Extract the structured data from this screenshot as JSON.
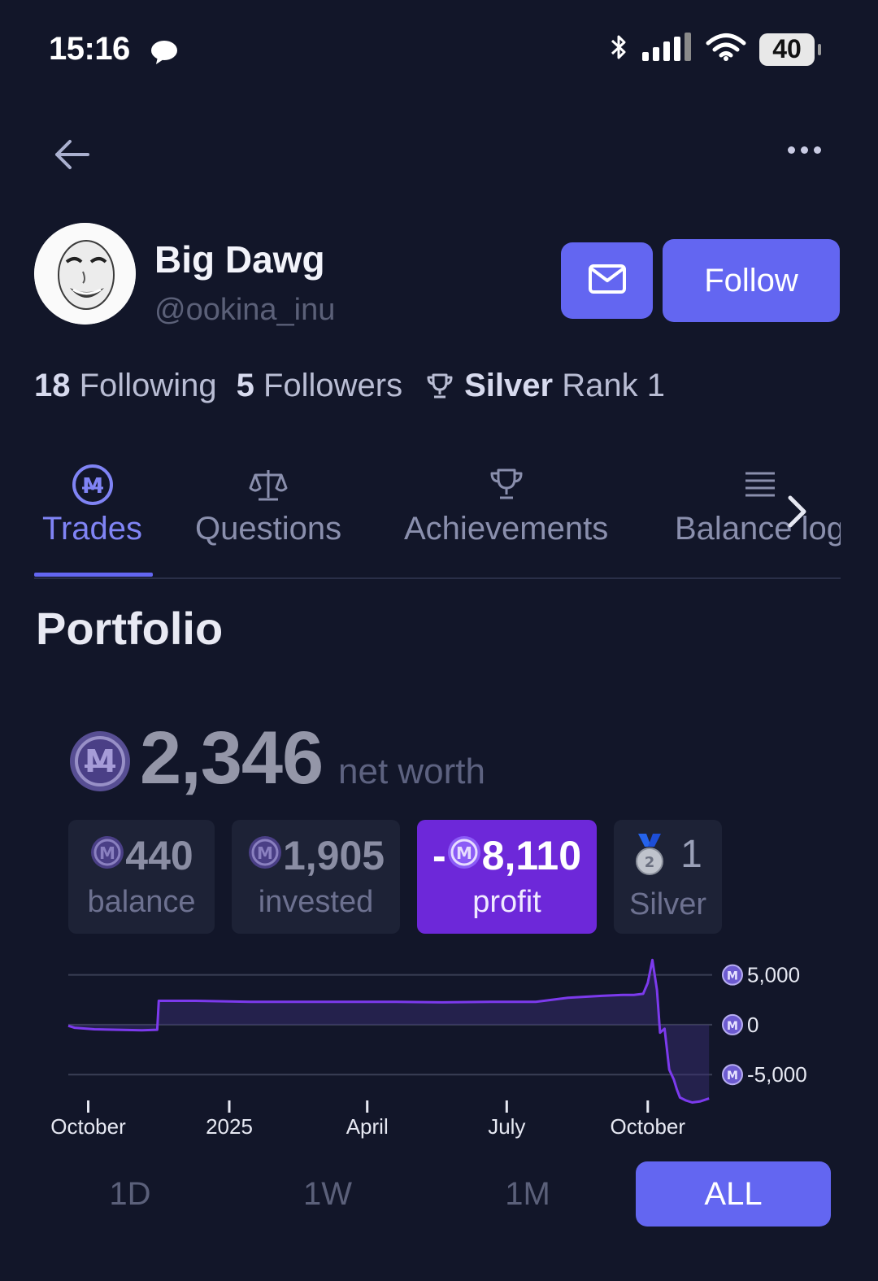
{
  "status_bar": {
    "time": "15:16",
    "battery": "40"
  },
  "profile": {
    "display_name": "Big Dawg",
    "username": "@ookina_inu",
    "follow_label": "Follow",
    "following_count": "18",
    "following_label": "Following",
    "followers_count": "5",
    "followers_label": "Followers",
    "league": "Silver",
    "rank_label": "Rank 1"
  },
  "tabs": [
    {
      "label": "Trades",
      "icon": "mana-coin-icon",
      "active": true
    },
    {
      "label": "Questions",
      "icon": "scales-icon"
    },
    {
      "label": "Achievements",
      "icon": "trophy-icon"
    },
    {
      "label": "Balance log",
      "icon": "list-icon"
    }
  ],
  "portfolio": {
    "heading": "Portfolio",
    "net_worth": "2,346",
    "net_worth_label": "net worth",
    "balance": "440",
    "balance_label": "balance",
    "invested": "1,905",
    "invested_label": "invested",
    "profit_sign": "-",
    "profit": "8,110",
    "profit_label": "profit",
    "rank_number": "1",
    "rank_label": "Silver",
    "medal_number": "2"
  },
  "colors": {
    "accent": "#6366f1",
    "profit_bg": "#6d28d9",
    "chart_line": "#7c3aed",
    "background": "#121629"
  },
  "chart_data": {
    "type": "area",
    "ylim": [
      -8000,
      7500
    ],
    "yticks": [
      5000,
      0,
      -5000
    ],
    "ytick_labels": [
      "5,000",
      "0",
      "-5,000"
    ],
    "xlim": [
      "2024-09-18",
      "2025-11-12"
    ],
    "xticks": [
      "2024-10-01",
      "2025-01-01",
      "2025-04-01",
      "2025-07-01",
      "2025-10-01"
    ],
    "xtick_labels": [
      "October",
      "2025",
      "April",
      "July",
      "October"
    ],
    "x": [
      "2024-09-18",
      "2024-09-22",
      "2024-10-05",
      "2024-10-20",
      "2024-11-05",
      "2024-11-15",
      "2024-11-16",
      "2024-12-10",
      "2025-01-15",
      "2025-02-20",
      "2025-03-20",
      "2025-04-20",
      "2025-05-20",
      "2025-06-20",
      "2025-07-20",
      "2025-08-10",
      "2025-09-01",
      "2025-09-15",
      "2025-09-22",
      "2025-09-28",
      "2025-10-01",
      "2025-10-04",
      "2025-10-07",
      "2025-10-09",
      "2025-10-12",
      "2025-10-15",
      "2025-10-18",
      "2025-10-20",
      "2025-10-22",
      "2025-10-26",
      "2025-10-30",
      "2025-11-04",
      "2025-11-10"
    ],
    "y": [
      -100,
      -300,
      -450,
      -500,
      -550,
      -500,
      2400,
      2400,
      2300,
      2300,
      2300,
      2300,
      2250,
      2300,
      2300,
      2700,
      2900,
      3000,
      3000,
      3100,
      4200,
      6500,
      3500,
      -800,
      -400,
      -4500,
      -5500,
      -6500,
      -7300,
      -7600,
      -7800,
      -7700,
      -7400
    ]
  }
}
